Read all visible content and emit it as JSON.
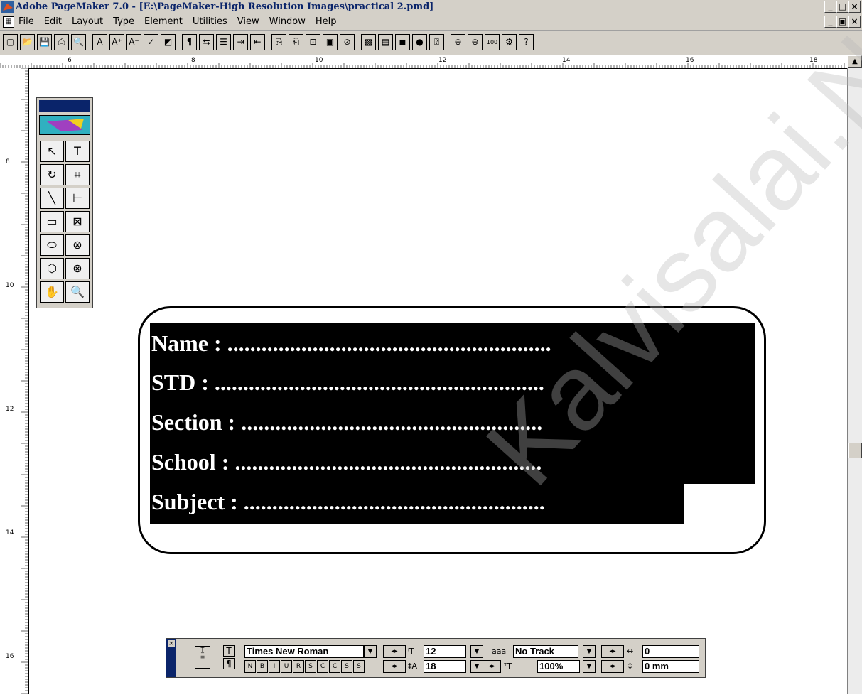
{
  "window": {
    "title": "Adobe PageMaker 7.0 - [E:\\PageMaker-High Resolution Images\\practical 2.pmd]",
    "controls": {
      "minimize": "_",
      "maximize": "□",
      "close": "×"
    },
    "doc_controls": {
      "minimize": "_",
      "restore": "▣",
      "close": "×"
    }
  },
  "menubar": {
    "items": [
      "File",
      "Edit",
      "Layout",
      "Type",
      "Element",
      "Utilities",
      "View",
      "Window",
      "Help"
    ]
  },
  "toolbar": {
    "buttons": [
      {
        "name": "new-icon",
        "glyph": "▢"
      },
      {
        "name": "open-icon",
        "glyph": "📂"
      },
      {
        "name": "save-icon",
        "glyph": "💾"
      },
      {
        "name": "print-icon",
        "glyph": "⎙"
      },
      {
        "name": "find-icon",
        "glyph": "🔍"
      },
      {
        "name": "font-icon",
        "glyph": "A"
      },
      {
        "name": "superscript-icon",
        "glyph": "A⁺"
      },
      {
        "name": "subscript-icon",
        "glyph": "A⁻"
      },
      {
        "name": "spellcheck-icon",
        "glyph": "✓"
      },
      {
        "name": "color-icon",
        "glyph": "◩"
      },
      {
        "name": "pilcrow-icon",
        "glyph": "¶"
      },
      {
        "name": "export-icon",
        "glyph": "⇆"
      },
      {
        "name": "bullets-icon",
        "glyph": "☰"
      },
      {
        "name": "indent-icon",
        "glyph": "⇥"
      },
      {
        "name": "outdent-icon",
        "glyph": "⇤"
      },
      {
        "name": "copy-icon",
        "glyph": "⎘"
      },
      {
        "name": "paste-icon",
        "glyph": "⎗"
      },
      {
        "name": "place-icon",
        "glyph": "⊡"
      },
      {
        "name": "frame-icon",
        "glyph": "▣"
      },
      {
        "name": "link-icon",
        "glyph": "⊘"
      },
      {
        "name": "image-icon",
        "glyph": "▩"
      },
      {
        "name": "layer-icon",
        "glyph": "▤"
      },
      {
        "name": "swatch-icon",
        "glyph": "◼"
      },
      {
        "name": "globe-icon",
        "glyph": "●"
      },
      {
        "name": "pdf-icon",
        "glyph": "⍰"
      },
      {
        "name": "zoom-in-icon",
        "glyph": "⊕"
      },
      {
        "name": "zoom-out-icon",
        "glyph": "⊖"
      },
      {
        "name": "actual-size-icon",
        "glyph": "100"
      },
      {
        "name": "plugin-icon",
        "glyph": "⚙"
      },
      {
        "name": "help-icon",
        "glyph": "?"
      }
    ]
  },
  "ruler_top": {
    "labels": [
      "6",
      "8",
      "10",
      "12",
      "14",
      "16",
      "18"
    ]
  },
  "ruler_left": {
    "labels": [
      "8",
      "10",
      "12",
      "14",
      "16"
    ]
  },
  "toolbox": {
    "tools": [
      {
        "name": "pointer-tool-icon",
        "glyph": "↖"
      },
      {
        "name": "text-tool-icon",
        "glyph": "T"
      },
      {
        "name": "rotate-tool-icon",
        "glyph": "↻"
      },
      {
        "name": "crop-tool-icon",
        "glyph": "⌗"
      },
      {
        "name": "line-tool-icon",
        "glyph": "╲"
      },
      {
        "name": "constrained-line-tool-icon",
        "glyph": "⊢"
      },
      {
        "name": "rectangle-tool-icon",
        "glyph": "▭"
      },
      {
        "name": "rectangle-frame-tool-icon",
        "glyph": "⊠"
      },
      {
        "name": "ellipse-tool-icon",
        "glyph": "⬭"
      },
      {
        "name": "ellipse-frame-tool-icon",
        "glyph": "⊗"
      },
      {
        "name": "polygon-tool-icon",
        "glyph": "⬡"
      },
      {
        "name": "polygon-frame-tool-icon",
        "glyph": "⊗"
      },
      {
        "name": "hand-tool-icon",
        "glyph": "✋"
      },
      {
        "name": "zoom-tool-icon",
        "glyph": "🔍"
      }
    ]
  },
  "document": {
    "lines": [
      "Name : .........................................................",
      "STD : ..........................................................",
      "Section : .....................................................",
      "School : ......................................................",
      "Subject : ....................................................."
    ]
  },
  "watermark": {
    "text": "Kalvisalai.Net"
  },
  "control_palette": {
    "font": "Times New Roman",
    "size": "12",
    "leading": "18",
    "track": "No Track",
    "width": "100%",
    "kerning": "0",
    "baseline_shift": "0 mm",
    "style_buttons": [
      "N",
      "B",
      "I",
      "U",
      "R",
      "S",
      "C",
      "C",
      "S",
      "S"
    ]
  }
}
